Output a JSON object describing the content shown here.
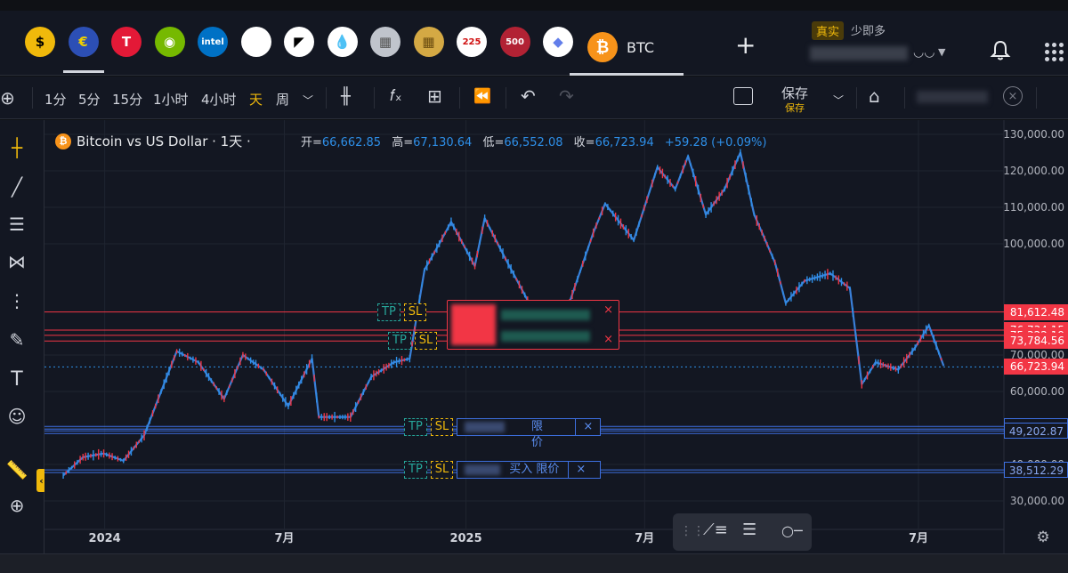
{
  "top_bar": {
    "assets": [
      {
        "name": "usd-coin-icon",
        "glyph": "$",
        "bg": "#f0b90b",
        "fg": "#000000"
      },
      {
        "name": "eurusd-icon",
        "glyph": "€",
        "bg": "#2c4fb5",
        "fg": "#f0d000"
      },
      {
        "name": "tesla-icon",
        "glyph": "T",
        "bg": "#e31937",
        "fg": "#ffffff"
      },
      {
        "name": "nvidia-icon",
        "glyph": "◉",
        "bg": "#76b900",
        "fg": "#ffffff"
      },
      {
        "name": "intel-icon",
        "glyph": "intel",
        "bg": "#0071c5",
        "fg": "#ffffff"
      },
      {
        "name": "apple-icon",
        "glyph": "",
        "bg": "#ffffff",
        "fg": "#000000"
      },
      {
        "name": "amd-icon",
        "glyph": "◤",
        "bg": "#ffffff",
        "fg": "#000000"
      },
      {
        "name": "oil-icon",
        "glyph": "💧",
        "bg": "#ffffff",
        "fg": "#000000"
      },
      {
        "name": "silver-icon",
        "glyph": "▦",
        "bg": "#c0c4cc",
        "fg": "#555555"
      },
      {
        "name": "gold-icon",
        "glyph": "▦",
        "bg": "#d4a944",
        "fg": "#6b4d10"
      },
      {
        "name": "nikkei225-icon",
        "glyph": "225",
        "bg": "#ffffff",
        "fg": "#d01010"
      },
      {
        "name": "sp500-icon",
        "glyph": "500",
        "bg": "#b22234",
        "fg": "#ffffff"
      },
      {
        "name": "ethereum-icon",
        "glyph": "◆",
        "bg": "#ffffff",
        "fg": "#627eea"
      }
    ],
    "active_symbol": "BTC",
    "account_mode": "真实",
    "account_label": "少即多"
  },
  "toolbar": {
    "intervals": [
      "1分",
      "5分",
      "15分",
      "1小时",
      "4小时",
      "天",
      "周"
    ],
    "active_interval": "天",
    "save_label": "保存",
    "save_sub": "保存"
  },
  "legend": {
    "title": "Bitcoin vs US Dollar · 1天 ·",
    "open_k": "开=",
    "open_v": "66,662.85",
    "high_k": "高=",
    "high_v": "67,130.64",
    "low_k": "低=",
    "low_v": "66,552.08",
    "close_k": "收=",
    "close_v": "66,723.94",
    "change": "+59.28 (+0.09%)"
  },
  "orders": {
    "tp": "TP",
    "sl": "SL",
    "limit_buy": "买入 限价",
    "limit": "限价",
    "close": "×"
  },
  "colors": {
    "up": "#2e8fe8",
    "down": "#f23645",
    "accent": "#f0b90b",
    "background": "#131722"
  },
  "chart_data": {
    "type": "line",
    "title": "Bitcoin vs US Dollar · 1天 ·",
    "xlabel": "",
    "ylabel": "",
    "x_ticks": [
      "2024",
      "7月",
      "2025",
      "7月",
      "7月"
    ],
    "x": [
      "2023-11-20",
      "2023-12-10",
      "2023-12-31",
      "2024-01-20",
      "2024-02-10",
      "2024-03-01",
      "2024-03-14",
      "2024-04-05",
      "2024-05-01",
      "2024-05-20",
      "2024-06-10",
      "2024-07-05",
      "2024-07-29",
      "2024-08-05",
      "2024-09-06",
      "2024-09-27",
      "2024-10-20",
      "2024-11-05",
      "2024-11-20",
      "2024-12-05",
      "2024-12-17",
      "2025-01-10",
      "2025-01-20",
      "2025-02-10",
      "2025-03-10",
      "2025-04-08",
      "2025-05-10",
      "2025-05-22",
      "2025-06-20",
      "2025-07-14",
      "2025-08-01",
      "2025-08-14",
      "2025-09-01",
      "2025-09-20",
      "2025-10-06",
      "2025-10-20",
      "2025-11-10",
      "2025-11-21",
      "2025-12-10",
      "2026-01-05",
      "2026-01-25",
      "2026-02-06",
      "2026-02-20",
      "2026-03-15",
      "2026-04-01",
      "2026-04-15",
      "2026-04-30"
    ],
    "y": [
      37000,
      42000,
      43000,
      41000,
      48000,
      62000,
      71000,
      68000,
      58000,
      70000,
      66000,
      56000,
      69000,
      53000,
      53000,
      64000,
      68000,
      69000,
      93000,
      100000,
      106000,
      94000,
      107000,
      96000,
      82000,
      78000,
      103000,
      111000,
      101000,
      121000,
      115000,
      124000,
      108000,
      115000,
      125000,
      108000,
      95000,
      84000,
      90000,
      92000,
      88000,
      62000,
      68000,
      66000,
      72000,
      78000,
      67000
    ],
    "ylim": [
      28000,
      132000
    ],
    "y_ticks": [
      30000,
      40000,
      50000,
      60000,
      70000,
      100000,
      110000,
      120000,
      130000
    ],
    "y_tick_labels": [
      "30,000.00",
      "40,000.00",
      "50,000.00",
      "60,000.00",
      "70,000.00",
      "100,000.00",
      "110,000.00",
      "120,000.00",
      "130,000.00"
    ],
    "price_lines": [
      {
        "value": 81612.48,
        "label": "81,612.48",
        "kind": "red"
      },
      {
        "value": 76734.15,
        "label": "76,734.15",
        "kind": "red"
      },
      {
        "value": 75322.19,
        "label": "75,322.19",
        "kind": "red"
      },
      {
        "value": 73784.56,
        "label": "73,784.56",
        "kind": "red"
      },
      {
        "value": 66723.94,
        "label": "66,723.94",
        "kind": "last"
      },
      {
        "value": 50413.07,
        "label": "50,413.07",
        "kind": "blue"
      },
      {
        "value": 49202.87,
        "label": "49,202.87",
        "kind": "blue"
      },
      {
        "value": 38512.29,
        "label": "38,512.29",
        "kind": "blue"
      }
    ],
    "grid": true,
    "legend": "top-left"
  }
}
